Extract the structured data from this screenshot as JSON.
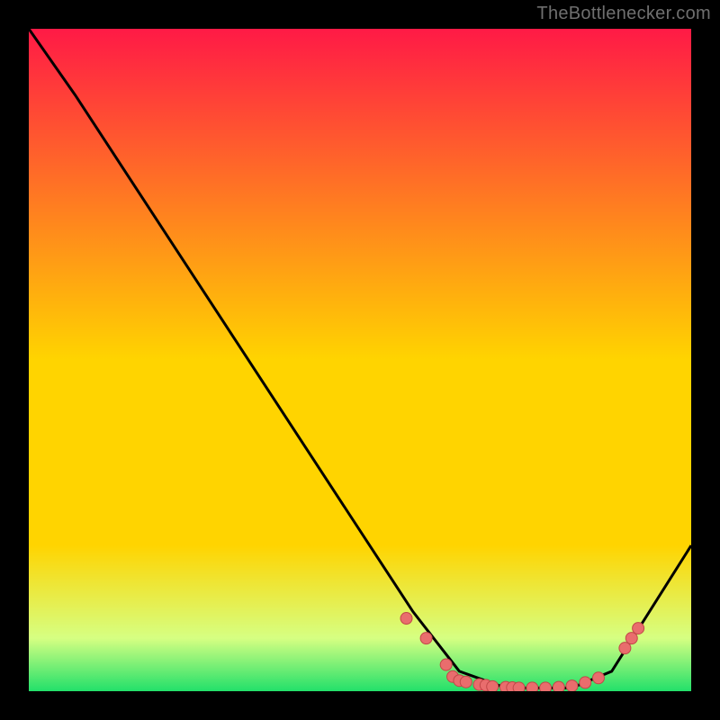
{
  "attribution": "TheBottlenecker.com",
  "colors": {
    "bg_black": "#000000",
    "grad_top": "#ff1a46",
    "grad_mid": "#ffd400",
    "grad_green_light": "#d6ff82",
    "grad_green": "#22e06a",
    "curve": "#000000",
    "marker_fill": "#e96d6d",
    "marker_stroke": "#c24848"
  },
  "chart_data": {
    "type": "line",
    "title": "",
    "xlabel": "",
    "ylabel": "",
    "xlim": [
      0,
      100
    ],
    "ylim": [
      0,
      100
    ],
    "curve": [
      {
        "x": 0,
        "y": 100
      },
      {
        "x": 7,
        "y": 90
      },
      {
        "x": 58,
        "y": 12
      },
      {
        "x": 65,
        "y": 3
      },
      {
        "x": 72,
        "y": 0.5
      },
      {
        "x": 82,
        "y": 0.5
      },
      {
        "x": 88,
        "y": 3
      },
      {
        "x": 100,
        "y": 22
      }
    ],
    "markers": [
      {
        "x": 57,
        "y": 11
      },
      {
        "x": 60,
        "y": 8
      },
      {
        "x": 63,
        "y": 4
      },
      {
        "x": 64,
        "y": 2.2
      },
      {
        "x": 65,
        "y": 1.6
      },
      {
        "x": 66,
        "y": 1.4
      },
      {
        "x": 68,
        "y": 1.0
      },
      {
        "x": 69,
        "y": 0.9
      },
      {
        "x": 70,
        "y": 0.7
      },
      {
        "x": 72,
        "y": 0.6
      },
      {
        "x": 73,
        "y": 0.55
      },
      {
        "x": 74,
        "y": 0.5
      },
      {
        "x": 76,
        "y": 0.5
      },
      {
        "x": 78,
        "y": 0.5
      },
      {
        "x": 80,
        "y": 0.6
      },
      {
        "x": 82,
        "y": 0.8
      },
      {
        "x": 84,
        "y": 1.3
      },
      {
        "x": 86,
        "y": 2.0
      },
      {
        "x": 90,
        "y": 6.5
      },
      {
        "x": 91,
        "y": 8.0
      },
      {
        "x": 92,
        "y": 9.5
      }
    ]
  }
}
